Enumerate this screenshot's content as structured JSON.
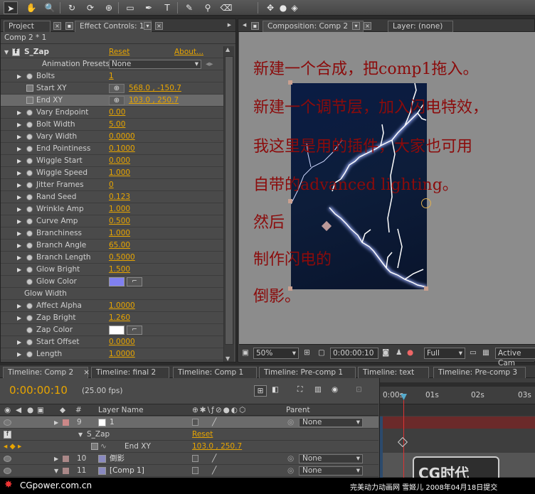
{
  "toolbar": {
    "tools": [
      "selection-tool",
      "hand-tool",
      "zoom-tool",
      "rotate-tool",
      "orbit-camera-tool",
      "track-xy-tool",
      "pan-behind-tool",
      "rectangle-tool",
      "pen-tool",
      "text-tool",
      "brush-tool",
      "eraser-tool",
      "axis-tool"
    ]
  },
  "left": {
    "tabs": {
      "project": "Project",
      "effect_controls": "Effect Controls: 1"
    },
    "comp_label": "Comp 2 * 1",
    "effect": {
      "name": "S_Zap",
      "reset": "Reset",
      "about": "About...",
      "presets_label": "Animation Presets:",
      "presets_value": "None"
    },
    "rows": [
      {
        "label": "Bolts",
        "value": "1",
        "tri": true
      },
      {
        "label": "Start XY",
        "value": "568.0 , -150.7",
        "point": true
      },
      {
        "label": "End XY",
        "value": "103.0 , 250.7",
        "point": true,
        "selected": true
      },
      {
        "label": "Vary Endpoint",
        "value": "0.00",
        "tri": true
      },
      {
        "label": "Bolt Width",
        "value": "5.00",
        "tri": true
      },
      {
        "label": "Vary Width",
        "value": "0.0000",
        "tri": true
      },
      {
        "label": "End Pointiness",
        "value": "0.1000",
        "tri": true
      },
      {
        "label": "Wiggle Start",
        "value": "0.000",
        "tri": true
      },
      {
        "label": "Wiggle Speed",
        "value": "1.000",
        "tri": true
      },
      {
        "label": "Jitter Frames",
        "value": "0",
        "tri": true
      },
      {
        "label": "Rand Seed",
        "value": "0.123",
        "tri": true
      },
      {
        "label": "Wrinkle Amp",
        "value": "1.000",
        "tri": true
      },
      {
        "label": "Curve Amp",
        "value": "0.500",
        "tri": true
      },
      {
        "label": "Branchiness",
        "value": "1.000",
        "tri": true
      },
      {
        "label": "Branch Angle",
        "value": "65.00",
        "tri": true
      },
      {
        "label": "Branch Length",
        "value": "0.5000",
        "tri": true
      },
      {
        "label": "Glow Bright",
        "value": "1.500",
        "tri": true
      },
      {
        "label": "Glow Color",
        "color": "#8080f0"
      },
      {
        "label": "Glow Width",
        "group": true
      },
      {
        "label": "Affect Alpha",
        "value": "1.0000",
        "tri": true
      },
      {
        "label": "Zap Bright",
        "value": "1.260",
        "tri": true
      },
      {
        "label": "Zap Color",
        "color": "#ffffff"
      },
      {
        "label": "Start Offset",
        "value": "0.0000",
        "tri": true
      },
      {
        "label": "Length",
        "value": "1.0000",
        "tri": true
      }
    ]
  },
  "comp": {
    "tab": "Composition: Comp 2",
    "layer_tab": "Layer: (none)",
    "lines": [
      "新建一个合成，把comp1拖入。",
      "新建一个调节层，加入闪电特效，",
      "我这里是用的插件，大家也可用",
      "自带的advanced lighting。",
      "然后",
      "制作闪电的",
      "倒影。"
    ],
    "zoom": "50%",
    "timecode": "0:00:00:10",
    "quality": "Full",
    "view": "Active Cam"
  },
  "timeline": {
    "tabs": [
      "Timeline: Comp 2",
      "Timeline: final 2",
      "Timeline: Comp 1",
      "Timeline: Pre-comp 1",
      "Timeline: text",
      "Timeline: Pre-comp 3"
    ],
    "timecode": "0:00:00:10",
    "fps": "(25.00 fps)",
    "cols": {
      "num": "#",
      "name": "Layer Name",
      "parent": "Parent"
    },
    "ticks": [
      "0:00s",
      "01s",
      "02s",
      "03s"
    ],
    "layers": [
      {
        "num": "9",
        "name": "1",
        "parent": "None"
      },
      {
        "num": "",
        "name": "S_Zap",
        "reset": "Reset"
      },
      {
        "num": "",
        "name": "End XY",
        "value": "103.0 , 250.7"
      },
      {
        "num": "10",
        "name": "倒影",
        "parent": "None"
      },
      {
        "num": "11",
        "name": "[Comp 1]",
        "parent": "None"
      }
    ]
  },
  "brand": {
    "left": "CGpower.com.cn",
    "right": "完美动力动画网 雪姬儿 2008年04月18日提交",
    "logo": "CG时代"
  }
}
